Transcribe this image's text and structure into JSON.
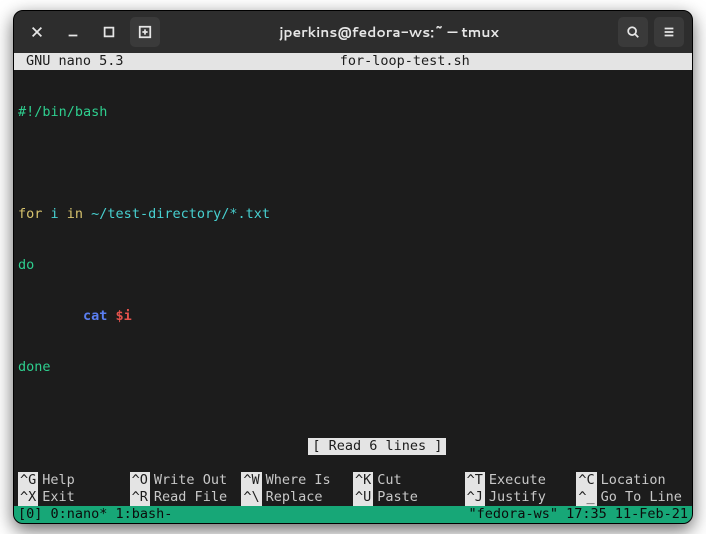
{
  "titlebar": {
    "title": "jperkins@fedora-ws:~ — tmux"
  },
  "nano": {
    "editor": "GNU nano 5.3",
    "filename": "for-loop-test.sh",
    "status": "[ Read 6 lines ]",
    "lines": {
      "l0": "#!/bin/bash",
      "l2_for": "for",
      "l2_var": " i ",
      "l2_in": "in",
      "l2_glob": " ~/test-directory/*.txt",
      "l3": "do",
      "l4_pad": "        ",
      "l4_cat": "cat ",
      "l4_arg": "$i",
      "l5": "done"
    },
    "shortcuts": [
      {
        "key": "^G",
        "label": "Help"
      },
      {
        "key": "^O",
        "label": "Write Out"
      },
      {
        "key": "^W",
        "label": "Where Is"
      },
      {
        "key": "^K",
        "label": "Cut"
      },
      {
        "key": "^T",
        "label": "Execute"
      },
      {
        "key": "^C",
        "label": "Location"
      },
      {
        "key": "^X",
        "label": "Exit"
      },
      {
        "key": "^R",
        "label": "Read File"
      },
      {
        "key": "^\\",
        "label": "Replace"
      },
      {
        "key": "^U",
        "label": "Paste"
      },
      {
        "key": "^J",
        "label": "Justify"
      },
      {
        "key": "^_",
        "label": "Go To Line"
      }
    ]
  },
  "tmux": {
    "left": "[0] 0:nano* 1:bash-",
    "right": "\"fedora-ws\" 17:35 11-Feb-21"
  }
}
